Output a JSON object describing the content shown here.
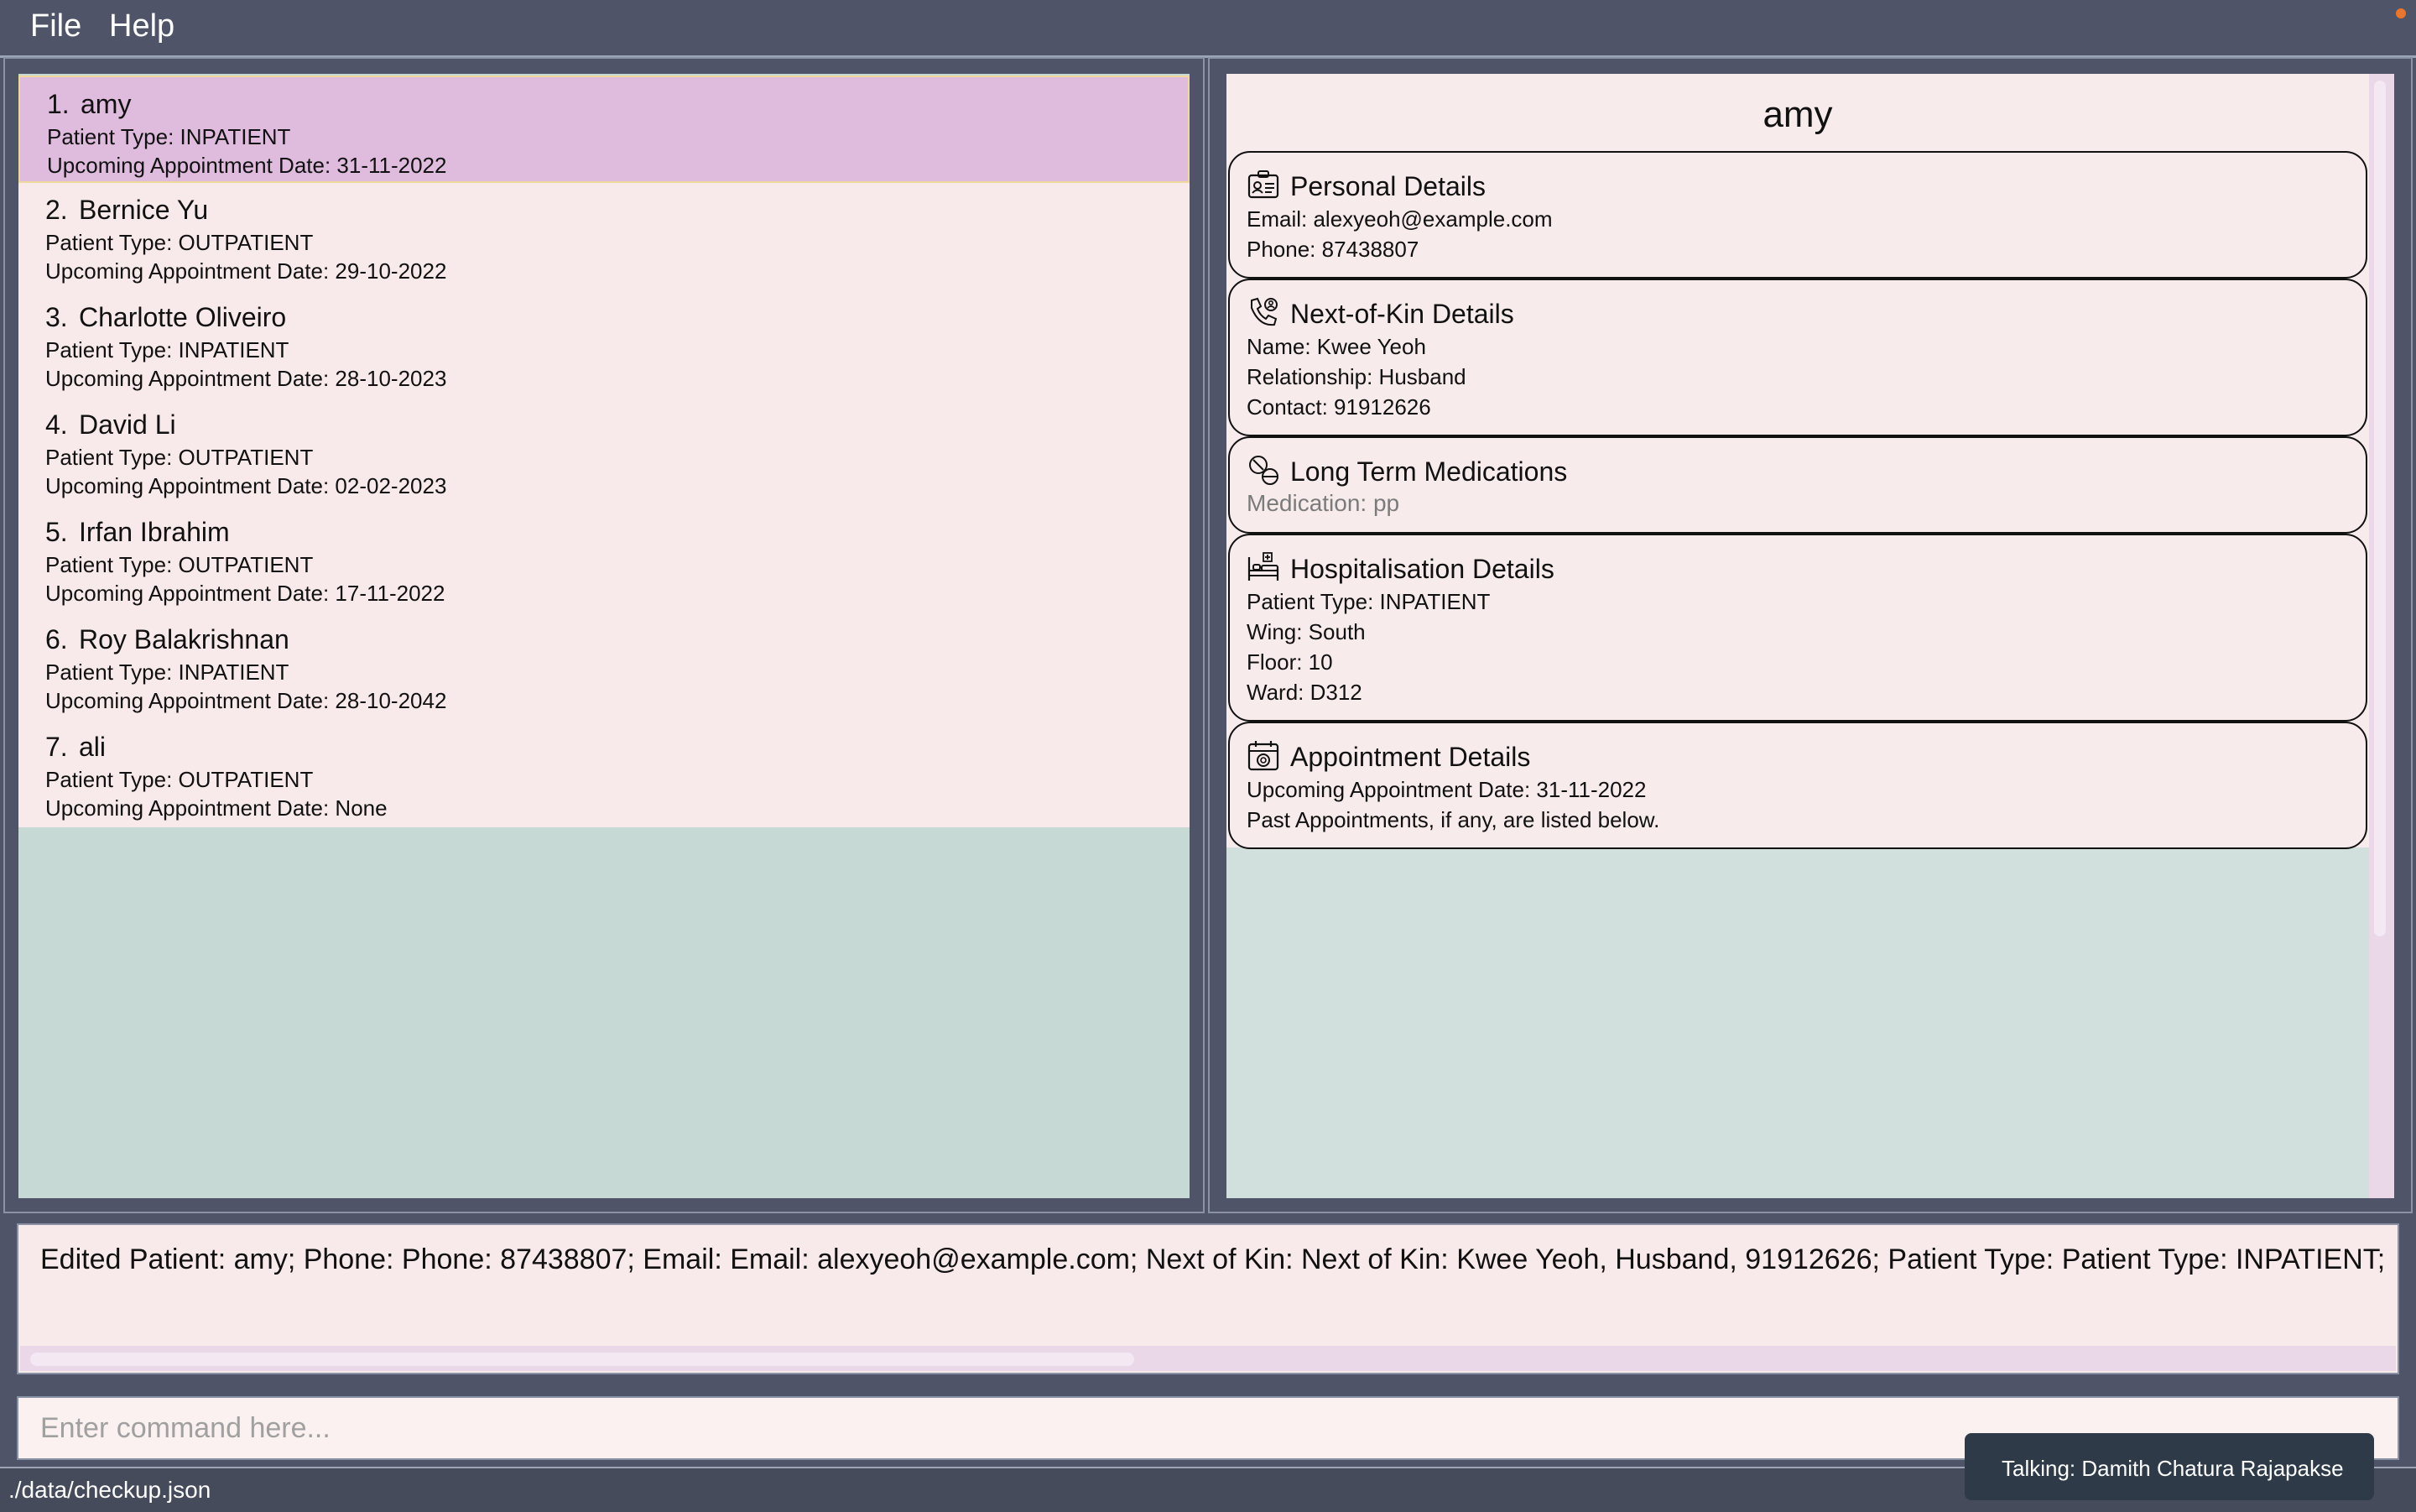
{
  "menu": {
    "file": "File",
    "help": "Help"
  },
  "patients": [
    {
      "index": "1.",
      "name": "amy",
      "type_line": "Patient Type: INPATIENT",
      "appt_line": "Upcoming Appointment Date: 31-11-2022",
      "selected": true
    },
    {
      "index": "2.",
      "name": "Bernice Yu",
      "type_line": "Patient Type: OUTPATIENT",
      "appt_line": "Upcoming Appointment Date: 29-10-2022"
    },
    {
      "index": "3.",
      "name": "Charlotte Oliveiro",
      "type_line": "Patient Type: INPATIENT",
      "appt_line": "Upcoming Appointment Date: 28-10-2023"
    },
    {
      "index": "4.",
      "name": "David Li",
      "type_line": "Patient Type: OUTPATIENT",
      "appt_line": "Upcoming Appointment Date: 02-02-2023"
    },
    {
      "index": "5.",
      "name": "Irfan Ibrahim",
      "type_line": "Patient Type: OUTPATIENT",
      "appt_line": "Upcoming Appointment Date: 17-11-2022"
    },
    {
      "index": "6.",
      "name": "Roy Balakrishnan",
      "type_line": "Patient Type: INPATIENT",
      "appt_line": "Upcoming Appointment Date: 28-10-2042"
    },
    {
      "index": "7.",
      "name": "ali",
      "type_line": "Patient Type: OUTPATIENT",
      "appt_line": "Upcoming Appointment Date: None"
    }
  ],
  "detail": {
    "name": "amy",
    "personal": {
      "icon": "id-card-icon",
      "title": "Personal Details",
      "email": "Email: alexyeoh@example.com",
      "phone": "Phone: 87438807"
    },
    "nok": {
      "icon": "phone-contact-icon",
      "title": "Next-of-Kin Details",
      "name": "Name: Kwee Yeoh",
      "relationship": "Relationship: Husband",
      "contact": "Contact: 91912626"
    },
    "medications": {
      "icon": "pills-icon",
      "title": "Long Term Medications",
      "medication": "Medication: pp"
    },
    "hospitalisation": {
      "icon": "hospital-bed-icon",
      "title": "Hospitalisation Details",
      "type": "Patient Type: INPATIENT",
      "wing": "Wing: South",
      "floor": "Floor: 10",
      "ward": "Ward: D312"
    },
    "appointment": {
      "icon": "calendar-icon",
      "title": "Appointment Details",
      "upcoming": "Upcoming Appointment Date: 31-11-2022",
      "past": "Past Appointments, if any, are listed below."
    }
  },
  "result": "Edited Patient: amy; Phone: Phone: 87438807; Email: Email: alexyeoh@example.com; Next of Kin: Next of Kin: Kwee Yeoh, Husband, 91912626; Patient Type: Patient Type: INPATIENT; Hospital Wing: South",
  "command": {
    "placeholder": "Enter command here...",
    "value": ""
  },
  "status": {
    "path": "./data/checkup.json"
  },
  "tooltip": "Talking: Damith Chatura Rajapakse",
  "colors": {
    "background": "#4f5468",
    "card": "#f8eaea",
    "selected": "#dfbbdd",
    "list_bg": "#c6d9d4",
    "notif_dot": "#e8762e"
  }
}
